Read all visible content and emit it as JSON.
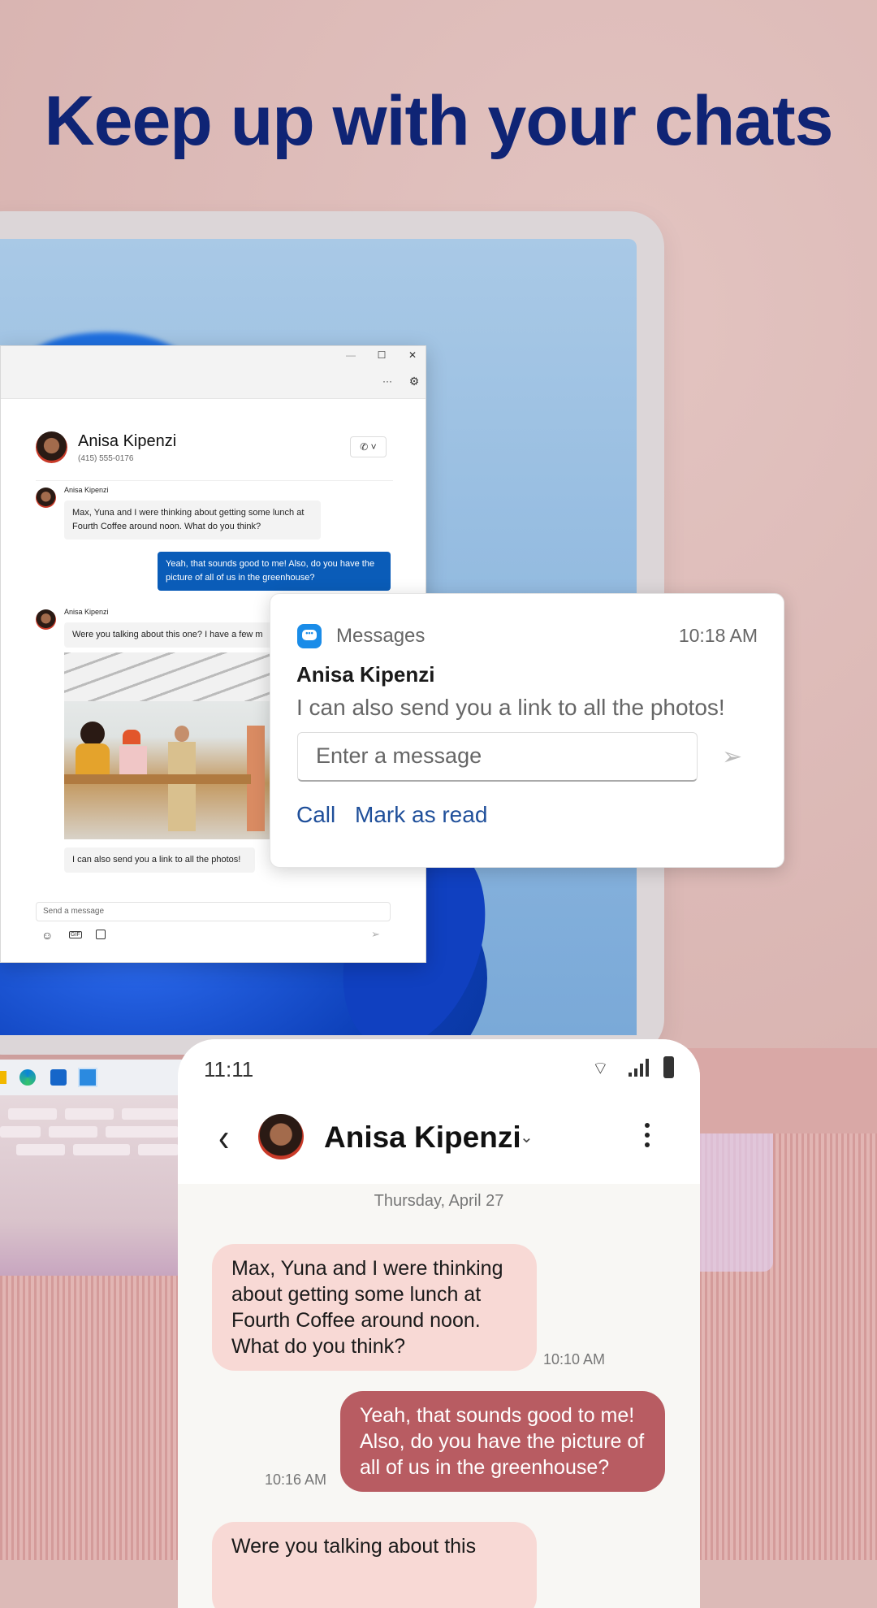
{
  "headline": "Keep up with your chats",
  "pc_window": {
    "controls": {
      "minimize": "—",
      "maximize": "☐",
      "close": "✕",
      "more": "···"
    },
    "contact": {
      "name": "Anisa Kipenzi",
      "phone": "(415) 555-0176"
    },
    "messages": [
      {
        "sender": "Anisa Kipenzi",
        "text": "Max, Yuna and I were thinking about getting some lunch at Fourth Coffee around noon. What do you think?",
        "direction": "incoming"
      },
      {
        "text": "Yeah, that sounds good to me! Also, do you have the picture of all of us in the greenhouse?",
        "direction": "outgoing"
      },
      {
        "sender": "Anisa Kipenzi",
        "text": "Were you talking about this one? I have a few m",
        "direction": "incoming",
        "has_image": true
      },
      {
        "text": "I can also send you a link to all the photos!",
        "direction": "incoming"
      }
    ],
    "composer_placeholder": "Send a message",
    "accent": "#0a5cb8"
  },
  "notification": {
    "app": "Messages",
    "time": "10:18 AM",
    "sender": "Anisa Kipenzi",
    "body": "I can also send you a link to all the photos!",
    "input_placeholder": "Enter a message",
    "actions": [
      "Call",
      "Mark as read"
    ],
    "icon_color": "#1a8ce8",
    "action_color": "#1f4f9a"
  },
  "phone": {
    "status_time": "11:11",
    "contact_name": "Anisa Kipenzi",
    "date_label": "Thursday, April 27",
    "messages": [
      {
        "text": "Max, Yuna and I were thinking about getting some lunch at Fourth Coffee around noon. What do you think?",
        "time": "10:10 AM",
        "direction": "incoming"
      },
      {
        "text": "Yeah, that sounds good to me! Also, do you have the picture of all of us in the greenhouse?",
        "time": "10:16 AM",
        "direction": "outgoing"
      },
      {
        "text": "Were you talking about this",
        "direction": "incoming"
      }
    ],
    "incoming_color": "#f8d9d5",
    "outgoing_color": "#b85c62"
  }
}
